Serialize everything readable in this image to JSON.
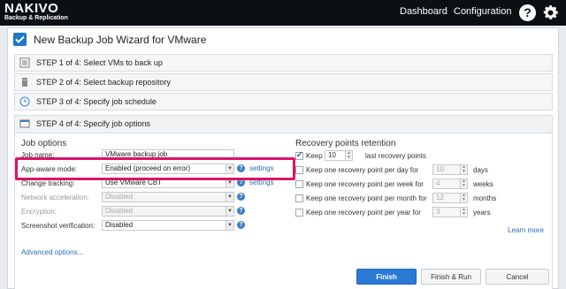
{
  "topbar": {
    "logo_main": "NAKIVO",
    "logo_sub": "Backup & Replication",
    "nav_dashboard": "Dashboard",
    "nav_configuration": "Configuration",
    "help_glyph": "?"
  },
  "wizard": {
    "title": "New Backup Job Wizard for VMware",
    "steps": [
      {
        "label": "STEP 1 of 4: Select VMs to back up",
        "icon": "vm-list-icon"
      },
      {
        "label": "STEP 2 of 4: Select backup repository",
        "icon": "repository-icon"
      },
      {
        "label": "STEP 3 of 4: Specify job schedule",
        "icon": "clock-icon"
      },
      {
        "label": "STEP 4 of 4: Specify job options",
        "icon": "options-icon"
      }
    ]
  },
  "job_options": {
    "title": "Job options",
    "job_name_label": "Job name:",
    "job_name_value": "VMware backup job",
    "app_aware_label": "App-aware mode:",
    "app_aware_value": "Enabled (proceed on error)",
    "app_aware_link": "settings",
    "change_tracking_label": "Change tracking:",
    "change_tracking_value": "Use VMware CBT",
    "change_tracking_link": "settings",
    "network_accel_label": "Network acceleration:",
    "network_accel_value": "Disabled",
    "encryption_label": "Encryption:",
    "encryption_value": "Disabled",
    "screenshot_label": "Screenshot verification:",
    "screenshot_value": "Disabled",
    "help_glyph": "?",
    "advanced_link": "Advanced options..."
  },
  "retention": {
    "title": "Recovery points retention",
    "keep_label": "Keep",
    "keep_value": "10",
    "keep_suffix": "last recovery points",
    "rows": [
      {
        "label": "Keep one recovery point per day for",
        "value": "10",
        "unit": "days"
      },
      {
        "label": "Keep one recovery point per week for",
        "value": "4",
        "unit": "weeks"
      },
      {
        "label": "Keep one recovery point per month for",
        "value": "12",
        "unit": "months"
      },
      {
        "label": "Keep one recovery point per year for",
        "value": "3",
        "unit": "years"
      }
    ],
    "learn_more": "Learn more"
  },
  "buttons": {
    "finish": "Finish",
    "finish_run": "Finish & Run",
    "cancel": "Cancel"
  },
  "colors": {
    "topbar_bg": "#0c0f14",
    "accent_blue": "#2b7bd6",
    "highlight_magenta": "#d8146a"
  }
}
